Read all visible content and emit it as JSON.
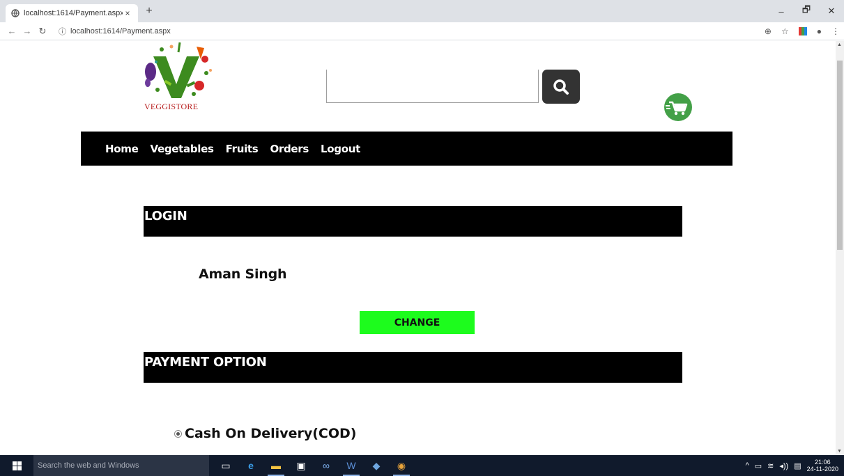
{
  "browser": {
    "tab_title": "localhost:1614/Payment.aspx",
    "tab_close": "×",
    "new_tab": "+",
    "address": "localhost:1614/Payment.aspx",
    "window_controls": {
      "minimize": "–",
      "restore": "🗗",
      "close": "✕"
    }
  },
  "site": {
    "brand": "VEGGISTORE",
    "search": {
      "value": "",
      "placeholder": ""
    },
    "nav": [
      "Home",
      "Vegetables",
      "Fruits",
      "Orders",
      "Logout"
    ]
  },
  "login_section": {
    "header": "LOGIN",
    "user_name": "Aman Singh",
    "change_label": "CHANGE"
  },
  "payment_section": {
    "header": "PAYMENT OPTION",
    "options": [
      {
        "label": "Cash On Delivery(COD)",
        "selected": true
      }
    ]
  },
  "taskbar": {
    "search_placeholder": "Search the web and Windows",
    "time": "21:06",
    "date": "24-11-2020"
  },
  "colors": {
    "change_button": "#1dfc1d",
    "nav_background": "#000000",
    "cart_green": "#43a047"
  }
}
